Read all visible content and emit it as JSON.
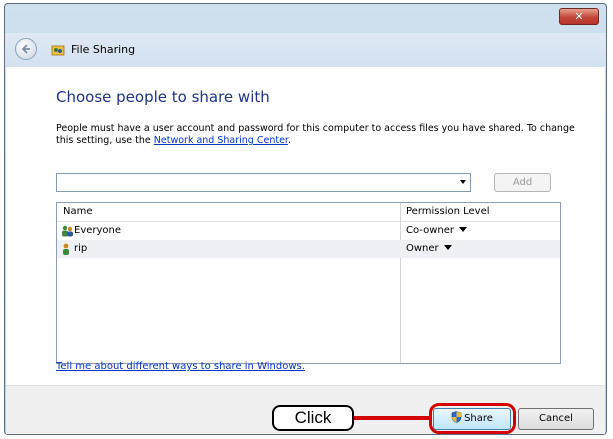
{
  "window": {
    "close_label": "✕"
  },
  "nav": {
    "title": "File Sharing"
  },
  "main": {
    "heading": "Choose people to share with",
    "description_prefix": "People must have a user account and password for this computer to access files you have shared.  To change this setting, use the ",
    "description_link": "Network and Sharing Center",
    "description_suffix": ".",
    "combo_value": "",
    "add_label": "Add"
  },
  "grid": {
    "headers": {
      "name": "Name",
      "permission": "Permission Level"
    },
    "rows": [
      {
        "name": "Everyone",
        "permission": "Co-owner",
        "icon": "group-users-icon"
      },
      {
        "name": "rip",
        "permission": "Owner",
        "icon": "user-icon"
      }
    ]
  },
  "help_link": "Tell me about different ways to share in Windows.",
  "footer": {
    "share_label": "Share",
    "cancel_label": "Cancel"
  },
  "annotation": {
    "callout_text": "Click",
    "color": "#d40000"
  },
  "colors": {
    "heading": "#1e3287",
    "link": "#0033cc",
    "close_button": "#c4473a"
  }
}
